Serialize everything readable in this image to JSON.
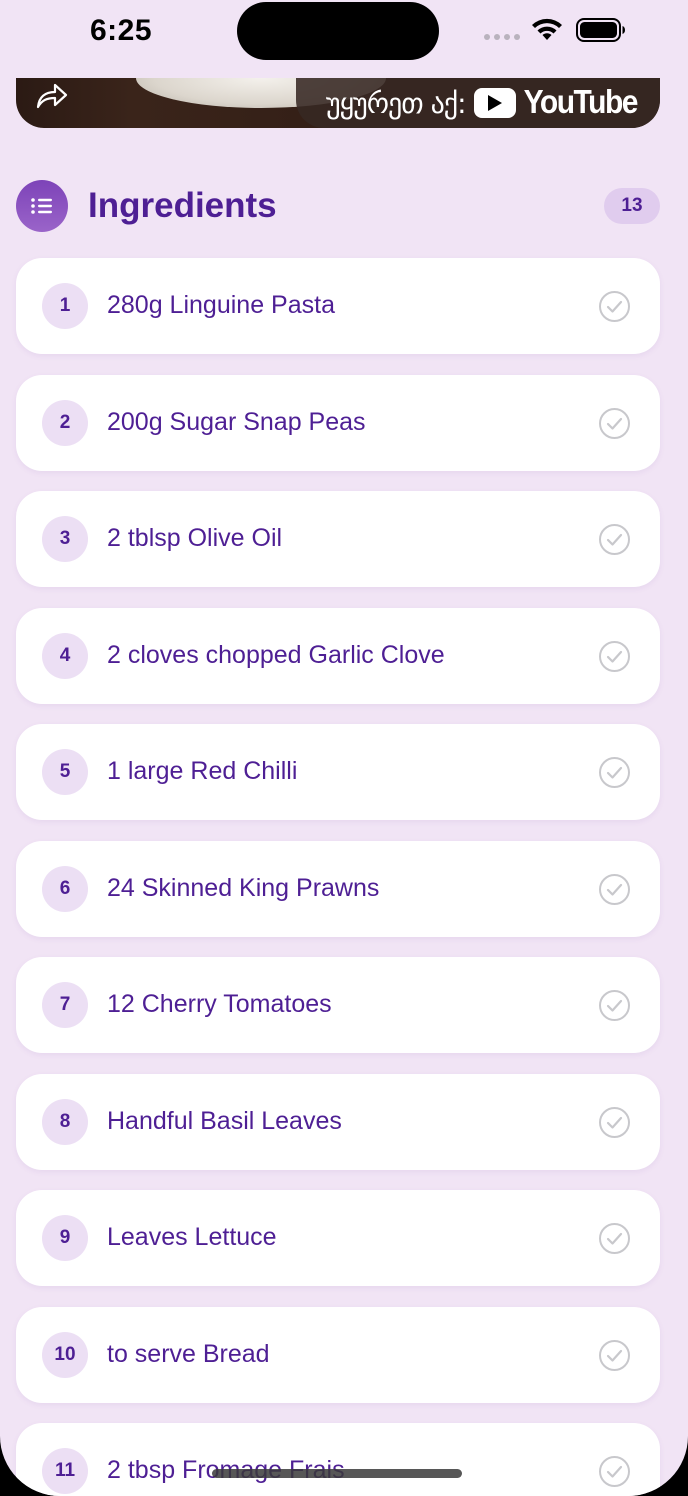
{
  "status_bar": {
    "time": "6:25"
  },
  "video": {
    "watch_label": "უყურეთ აქ:",
    "platform_label": "YouTube"
  },
  "ingredients_section": {
    "title": "Ingredients",
    "count": "13"
  },
  "ingredients": [
    {
      "number": "1",
      "text": "280g Linguine Pasta"
    },
    {
      "number": "2",
      "text": "200g Sugar Snap Peas"
    },
    {
      "number": "3",
      "text": "2 tblsp Olive Oil"
    },
    {
      "number": "4",
      "text": "2 cloves chopped Garlic Clove"
    },
    {
      "number": "5",
      "text": "1 large Red Chilli"
    },
    {
      "number": "6",
      "text": "24 Skinned King Prawns"
    },
    {
      "number": "7",
      "text": "12 Cherry Tomatoes"
    },
    {
      "number": "8",
      "text": "Handful Basil Leaves"
    },
    {
      "number": "9",
      "text": "Leaves Lettuce"
    },
    {
      "number": "10",
      "text": "to serve Bread"
    },
    {
      "number": "11",
      "text": "2 tbsp Fromage Frais"
    }
  ],
  "colors": {
    "background": "#f1e4f5",
    "accent": "#4e1f94",
    "badge_bg": "#e0ccee",
    "icon_gradient_start": "#7d43b8",
    "check_stroke": "#c8c8cc"
  },
  "icons": {
    "share": "share-arrow-icon",
    "list": "list-icon",
    "check": "checkmark-circle-icon",
    "youtube": "youtube-play-icon"
  }
}
